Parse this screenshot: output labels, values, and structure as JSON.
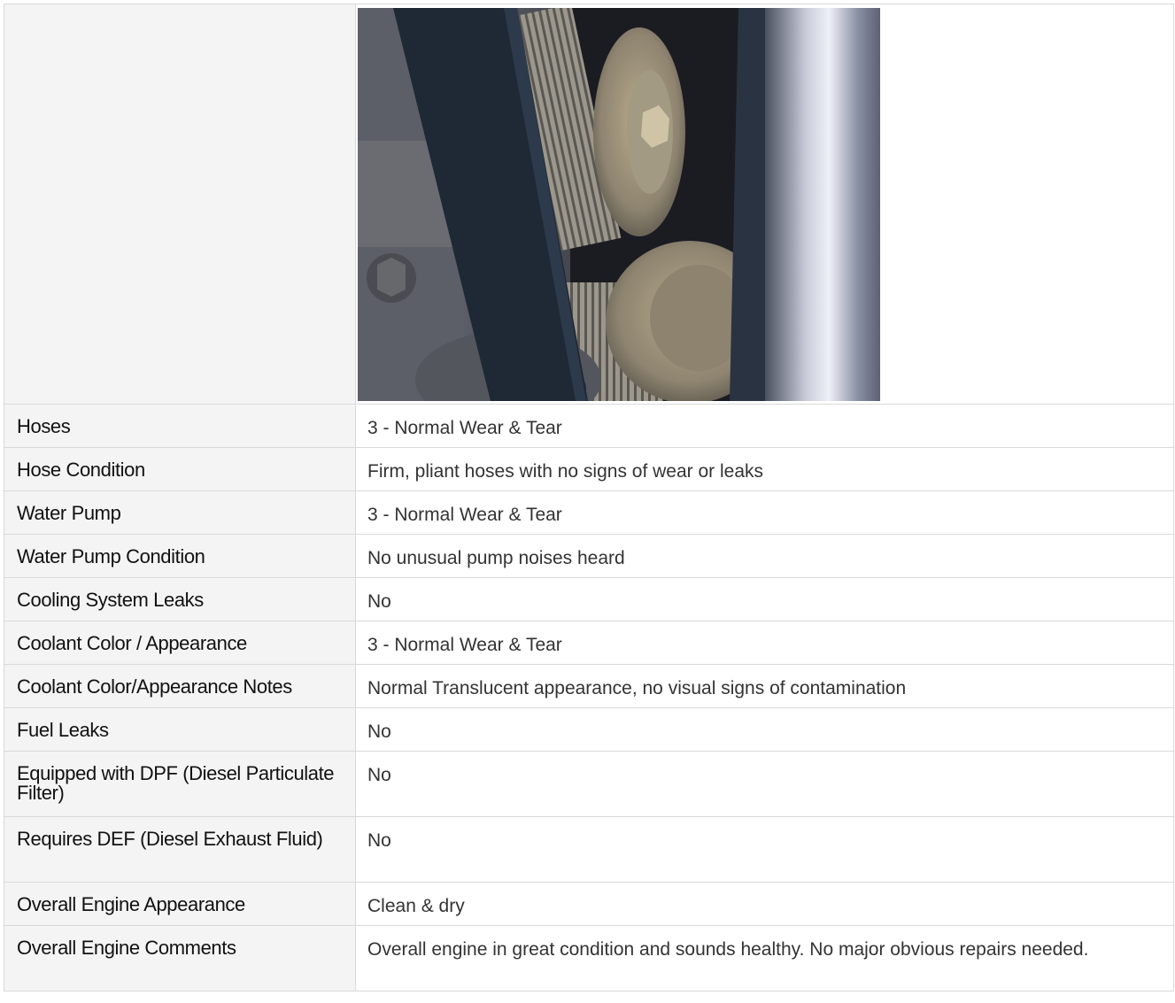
{
  "rows": [
    {
      "label": "Hoses",
      "value": "3 - Normal Wear & Tear"
    },
    {
      "label": "Hose Condition",
      "value": "Firm, pliant hoses with no signs of wear or leaks"
    },
    {
      "label": "Water Pump",
      "value": "3 - Normal Wear & Tear"
    },
    {
      "label": "Water Pump Condition",
      "value": "No unusual pump noises heard"
    },
    {
      "label": "Cooling System Leaks",
      "value": "No"
    },
    {
      "label": "Coolant Color / Appearance",
      "value": "3 - Normal Wear & Tear"
    },
    {
      "label": "Coolant Color/Appearance Notes",
      "value": "Normal Translucent appearance, no visual signs of contamination"
    },
    {
      "label": "Fuel Leaks",
      "value": "No"
    },
    {
      "label": "Equipped with DPF (Diesel Particulate Filter)",
      "value": "No"
    },
    {
      "label": "Requires DEF (Diesel Exhaust Fluid)",
      "value": "No"
    },
    {
      "label": "Overall Engine Appearance",
      "value": "Clean & dry"
    },
    {
      "label": "Overall Engine Comments",
      "value": "Overall engine in great condition and sounds healthy. No major obvious repairs needed."
    }
  ],
  "colors": {
    "label_bg": "#f4f4f4",
    "border": "#d9d9d9",
    "label_text": "#111111",
    "value_text": "#333333"
  }
}
